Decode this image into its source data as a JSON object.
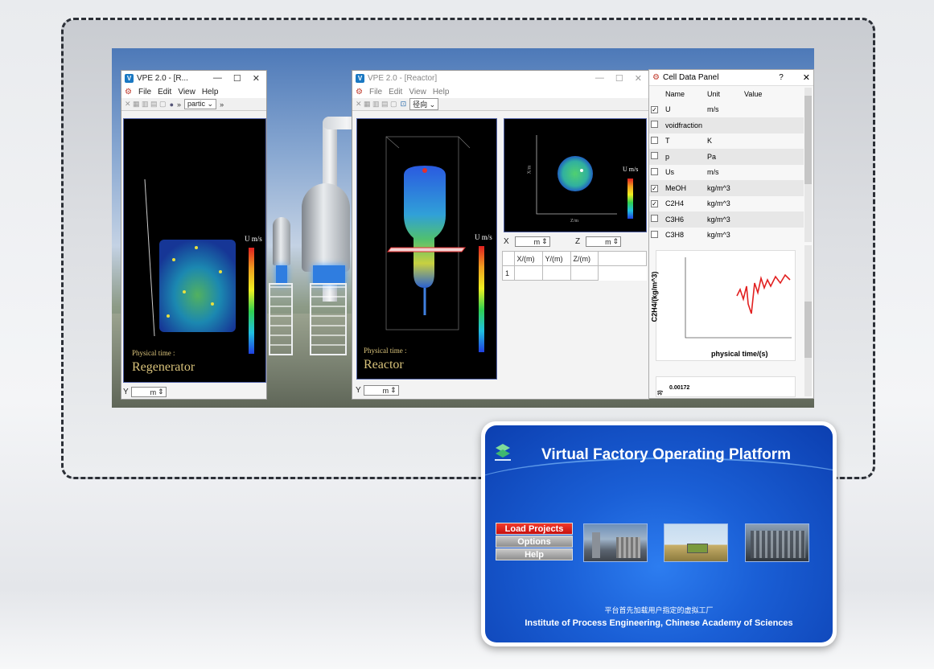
{
  "window_left": {
    "title": "VPE 2.0 - [R...",
    "menu": [
      "File",
      "Edit",
      "View",
      "Help"
    ],
    "dropdown": "partic",
    "physical_time_label": "Physical time :",
    "object_name": "Regenerator",
    "colorbar_label": "U m/s",
    "y_field_label": "Y",
    "y_field_unit": "m"
  },
  "window_center": {
    "title": "VPE 2.0 - [Reactor]",
    "menu": [
      "File",
      "Edit",
      "View",
      "Help"
    ],
    "dropdown": "径向",
    "physical_time_label": "Physical time :",
    "object_name": "Reactor",
    "colorbar_label": "U m/s",
    "slice_colorbar_label": "U m/s",
    "slice_axis_x": "Z/m",
    "slice_axis_y": "X/m",
    "x_field_label": "X",
    "x_field_unit": "m",
    "z_field_label": "Z",
    "z_field_unit": "m",
    "y_field_label": "Y",
    "y_field_unit": "m",
    "grid_headers": [
      "X/(m)",
      "Y/(m)",
      "Z/(m)"
    ],
    "grid_row_index": "1"
  },
  "cell_panel": {
    "title": "Cell Data Panel",
    "help": "?",
    "close": "✕",
    "columns": [
      "Name",
      "Unit",
      "Value"
    ],
    "rows": [
      {
        "checked": true,
        "name": "U",
        "unit": "m/s"
      },
      {
        "checked": false,
        "name": "voidfraction",
        "unit": ""
      },
      {
        "checked": false,
        "name": "T",
        "unit": "K"
      },
      {
        "checked": false,
        "name": "p",
        "unit": "Pa"
      },
      {
        "checked": false,
        "name": "Us",
        "unit": "m/s"
      },
      {
        "checked": true,
        "name": "MeOH",
        "unit": "kg/m^3"
      },
      {
        "checked": true,
        "name": "C2H4",
        "unit": "kg/m^3"
      },
      {
        "checked": false,
        "name": "C3H6",
        "unit": "kg/m^3"
      },
      {
        "checked": false,
        "name": "C3H8",
        "unit": "kg/m^3"
      }
    ],
    "plot_ylabel": "C2H4/(kg/m^3)",
    "plot_xlabel": "physical time/(s)",
    "plot2_tick_1": "0.00172",
    "plot2_ylabel_fragment": "3)"
  },
  "splash": {
    "title": "Virtual Factory Operating Platform",
    "buttons": [
      "Load Projects",
      "Options",
      "Help"
    ],
    "chinese_note": "平台首先加载用户指定的虚拟工厂",
    "institute": "Institute of Process Engineering, Chinese Academy of Sciences"
  },
  "colors": {
    "splash_blue": "#1a5fd6",
    "active_button": "#e02a1c",
    "frame_border": "#2b2f36"
  }
}
